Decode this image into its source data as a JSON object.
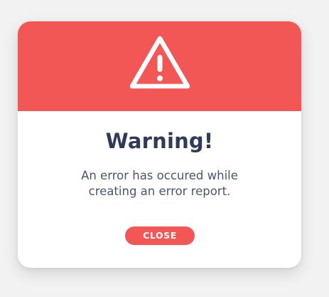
{
  "dialog": {
    "icon": "warning-triangle-icon",
    "title": "Warning!",
    "message_line1": "An error has occured while",
    "message_line2": "creating an error report.",
    "close_label": "CLOSE"
  },
  "colors": {
    "background": "#f2f2f2",
    "accent": "#f25755",
    "title": "#2f3b57",
    "message": "#4a5670",
    "button_text": "#ffffff"
  }
}
